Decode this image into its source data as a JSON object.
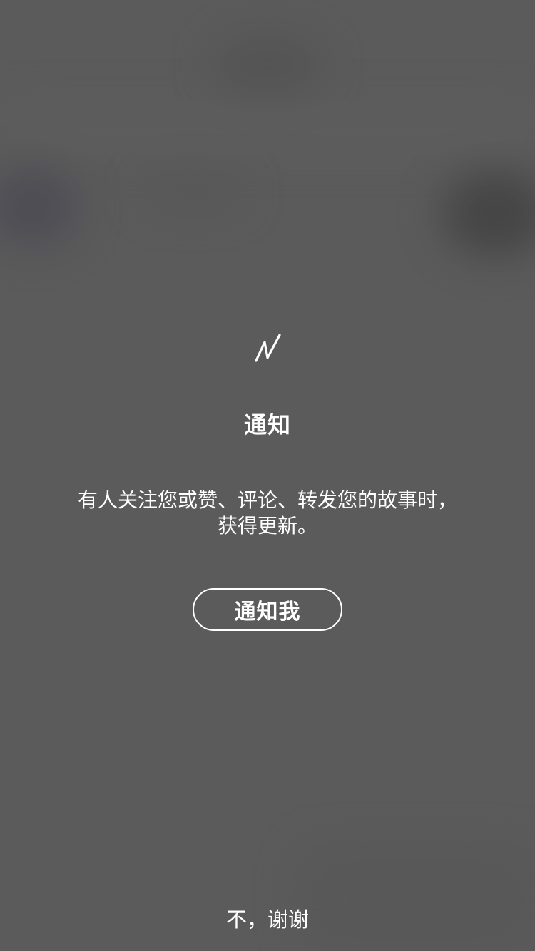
{
  "theme": {
    "background": "#5b5b5b",
    "text": "#ffffff",
    "button_border": "#ffffff"
  },
  "prompt": {
    "logo_icon": "lightning-n-logo-icon",
    "title": "通知",
    "description_line1": "有人关注您或赞、评论、转发您的故事时，",
    "description_line2": "获得更新。",
    "notify_button_label": "通知我",
    "decline_label": "不，谢谢"
  }
}
